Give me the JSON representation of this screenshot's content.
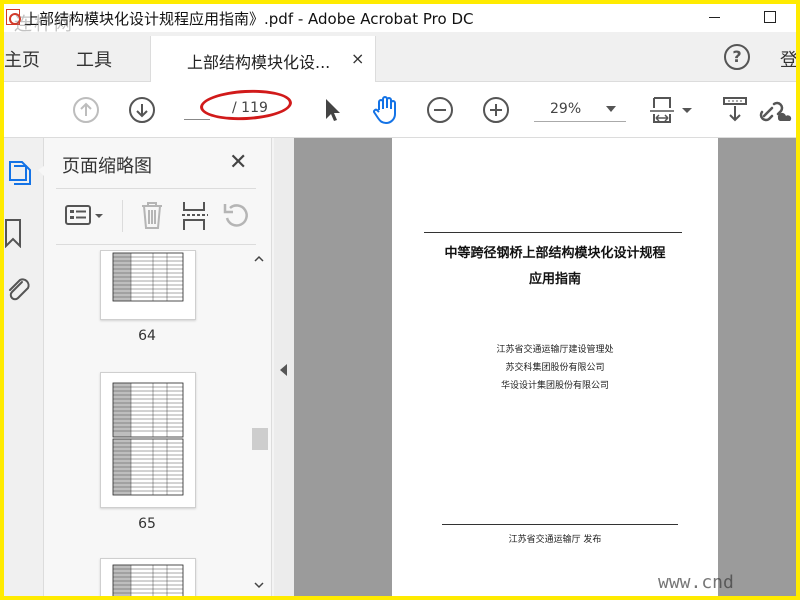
{
  "window": {
    "title": "上部结构模块化设计规程应用指南》.pdf - Adobe Acrobat Pro DC",
    "watermark": "连杯网"
  },
  "tabbar": {
    "home": "主页",
    "tools": "工具",
    "doc_tab_label": "上部结构模块化设...",
    "doc_tab_close": "×",
    "help": "?",
    "signin": "登"
  },
  "toolbar": {
    "page_current": "",
    "page_total": "/ 119",
    "zoom": "29%",
    "annotation_color": "#d11a1a"
  },
  "thumbnails_panel": {
    "title": "页面缩略图",
    "close": "✕",
    "pages": [
      {
        "label": "64"
      },
      {
        "label": "65"
      },
      {
        "label": ""
      }
    ]
  },
  "document": {
    "title_line1": "中等跨径钢桥上部结构模块化设计规程",
    "title_line2": "应用指南",
    "organizations": [
      "江苏省交通运输厅建设管理处",
      "苏交科集团股份有限公司",
      "华设设计集团股份有限公司"
    ],
    "publisher": "江苏省交通运输厅 发布"
  },
  "corner_watermark": "www.cnd",
  "colors": {
    "frame": "#ffeb00",
    "accent_blue": "#1473e6",
    "icon_gray": "#555555"
  }
}
